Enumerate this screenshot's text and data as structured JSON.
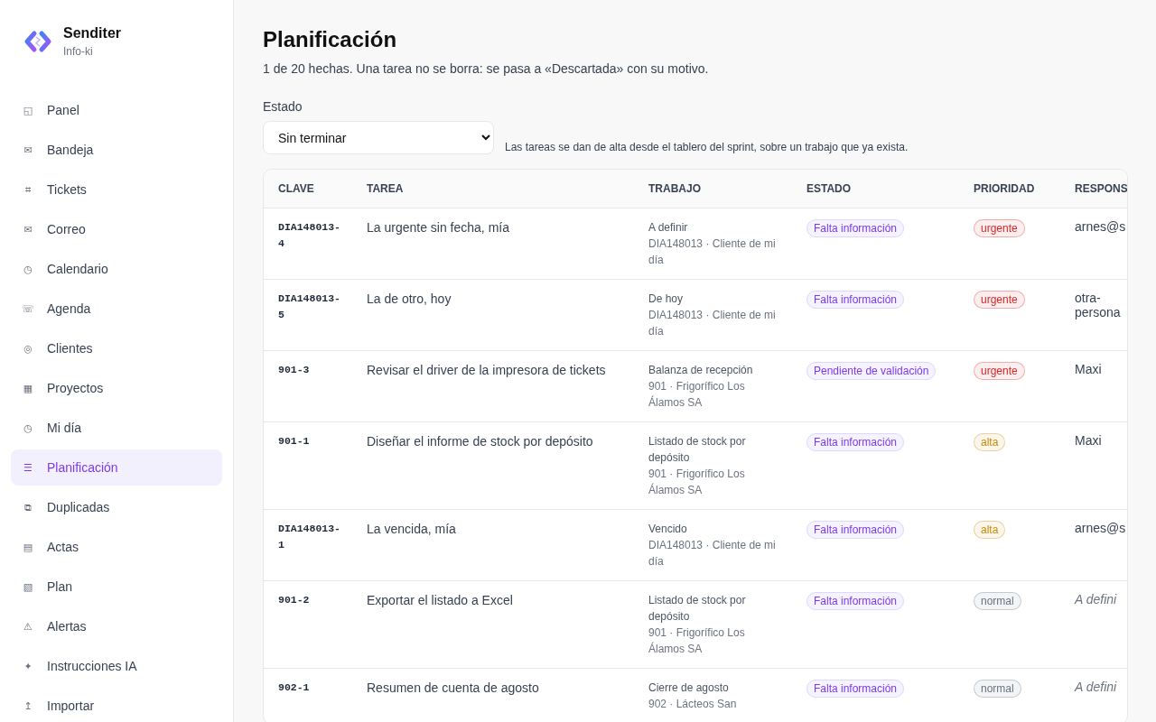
{
  "brand": {
    "name": "Senditer",
    "subtitle": "Info-ki"
  },
  "sidebar": {
    "items": [
      {
        "icon": "◱",
        "label": "Panel",
        "selected": false
      },
      {
        "icon": "✉",
        "label": "Bandeja",
        "selected": false
      },
      {
        "icon": "⌗",
        "label": "Tickets",
        "selected": false
      },
      {
        "icon": "✉",
        "label": "Correo",
        "selected": false
      },
      {
        "icon": "◷",
        "label": "Calendario",
        "selected": false
      },
      {
        "icon": "☏",
        "label": "Agenda",
        "selected": false
      },
      {
        "icon": "◎",
        "label": "Clientes",
        "selected": false
      },
      {
        "icon": "▦",
        "label": "Proyectos",
        "selected": false
      },
      {
        "icon": "◷",
        "label": "Mi día",
        "selected": false
      },
      {
        "icon": "☰",
        "label": "Planificación",
        "selected": true
      },
      {
        "icon": "⧉",
        "label": "Duplicadas",
        "selected": false
      },
      {
        "icon": "▤",
        "label": "Actas",
        "selected": false
      },
      {
        "icon": "▧",
        "label": "Plan",
        "selected": false
      },
      {
        "icon": "⚠",
        "label": "Alertas",
        "selected": false
      },
      {
        "icon": "✦",
        "label": "Instrucciones IA",
        "selected": false
      },
      {
        "icon": "↥",
        "label": "Importar",
        "selected": false
      }
    ]
  },
  "page": {
    "title": "Planificación",
    "subtitle": "1 de 20 hechas. Una tarea no se borra: se pasa a «Descartada» con su motivo."
  },
  "filter": {
    "label": "Estado",
    "value": "Sin terminar",
    "hint": "Las tareas se dan de alta desde el tablero del sprint, sobre un trabajo que ya exista."
  },
  "table": {
    "columns": [
      "CLAVE",
      "TAREA",
      "TRABAJO",
      "ESTADO",
      "PRIORIDAD",
      "RESPONS"
    ],
    "rows": [
      {
        "key": "DIA148013-4",
        "task": "La urgente sin fecha, mía",
        "work": "A definir",
        "work_detail": "DIA148013 · Cliente de mi día",
        "status": "Falta información",
        "priority": {
          "label": "urgente",
          "color": "#dc2626"
        },
        "owner": "arnes@s",
        "assigned": true
      },
      {
        "key": "DIA148013-5",
        "task": "La de otro, hoy",
        "work": "De hoy",
        "work_detail": "DIA148013 · Cliente de mi día",
        "status": "Falta información",
        "priority": {
          "label": "urgente",
          "color": "#dc2626"
        },
        "owner": "otra-persona",
        "assigned": true
      },
      {
        "key": "901-3",
        "task": "Revisar el driver de la impresora de tickets",
        "work": "Balanza de recepción",
        "work_detail": "901 · Frigorífico Los Álamos SA",
        "status": "Pendiente de validación",
        "priority": {
          "label": "urgente",
          "color": "#dc2626"
        },
        "owner": "Maxi",
        "assigned": true
      },
      {
        "key": "901-1",
        "task": "Diseñar el informe de stock por depósito",
        "work": "Listado de stock por depósito",
        "work_detail": "901 · Frigorífico Los Álamos SA",
        "status": "Falta información",
        "priority": {
          "label": "alta",
          "color": "#ca8a04"
        },
        "owner": "Maxi",
        "assigned": true
      },
      {
        "key": "DIA148013-1",
        "task": "La vencida, mía",
        "work": "Vencido",
        "work_detail": "DIA148013 · Cliente de mi día",
        "status": "Falta información",
        "priority": {
          "label": "alta",
          "color": "#ca8a04"
        },
        "owner": "arnes@s",
        "assigned": true
      },
      {
        "key": "901-2",
        "task": "Exportar el listado a Excel",
        "work": "Listado de stock por depósito",
        "work_detail": "901 · Frigorífico Los Álamos SA",
        "status": "Falta información",
        "priority": {
          "label": "normal",
          "color": "#6b7280"
        },
        "owner": "A defini",
        "assigned": false
      },
      {
        "key": "902-1",
        "task": "Resumen de cuenta de agosto",
        "work": "Cierre de agosto",
        "work_detail": "902 · Lácteos San",
        "status": "Falta información",
        "priority": {
          "label": "normal",
          "color": "#6b7280"
        },
        "owner": "A defini",
        "assigned": false
      }
    ]
  }
}
